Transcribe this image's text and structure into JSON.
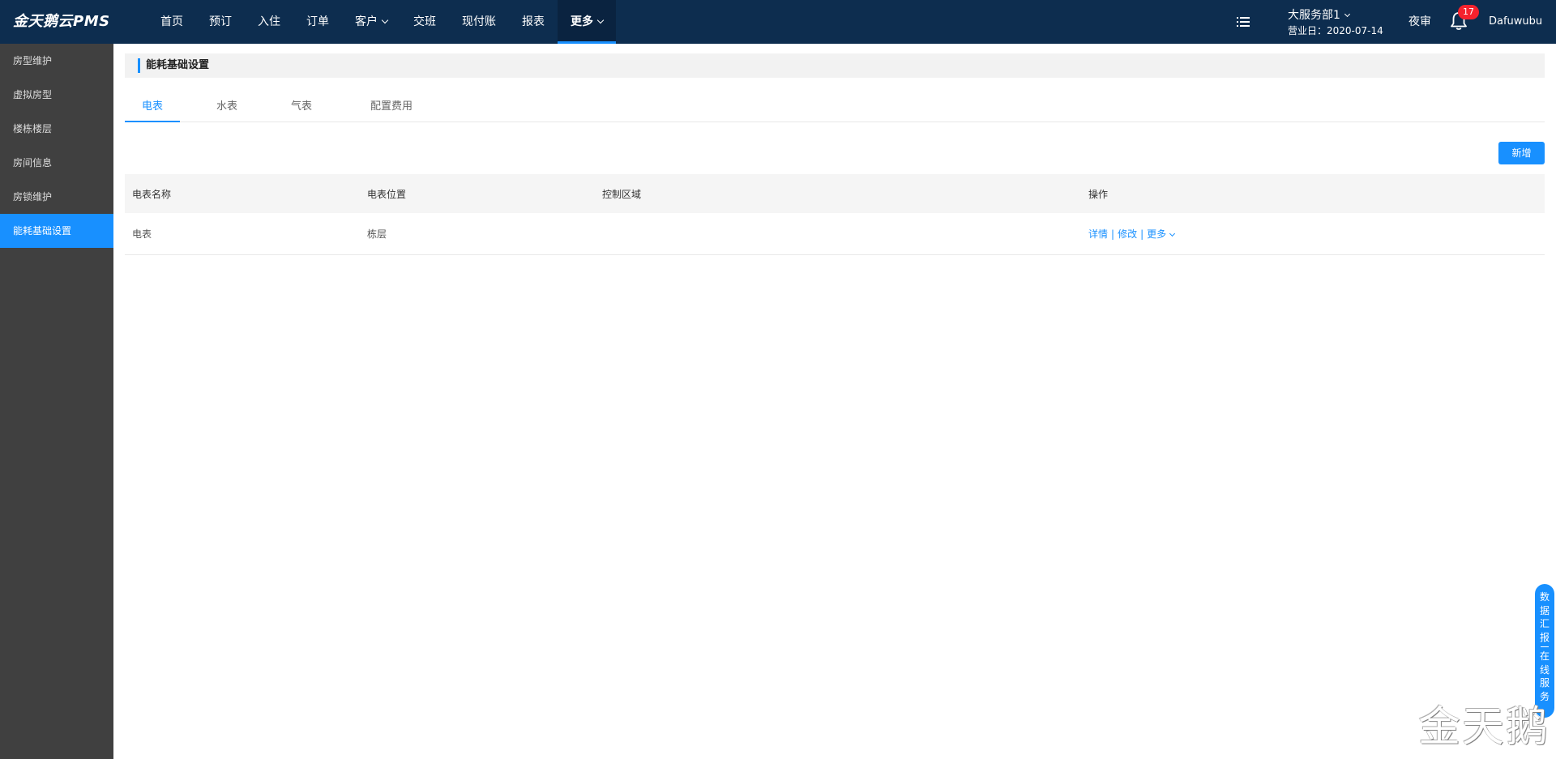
{
  "app": {
    "logo": "金天鹅云PMS"
  },
  "nav": {
    "items": [
      {
        "label": "首页"
      },
      {
        "label": "预订"
      },
      {
        "label": "入住"
      },
      {
        "label": "订单"
      },
      {
        "label": "客户"
      },
      {
        "label": "交班"
      },
      {
        "label": "现付账"
      },
      {
        "label": "报表"
      },
      {
        "label": "更多"
      }
    ],
    "active": "更多"
  },
  "header": {
    "department": "大服务部1",
    "business_date": "营业日：2020-07-14",
    "night_audit": "夜审",
    "notification_count": "17",
    "username": "Dafuwubu"
  },
  "sidebar": {
    "items": [
      {
        "label": "房型维护"
      },
      {
        "label": "虚拟房型"
      },
      {
        "label": "楼栋楼层"
      },
      {
        "label": "房间信息"
      },
      {
        "label": "房锁维护"
      },
      {
        "label": "能耗基础设置"
      }
    ],
    "active": "能耗基础设置"
  },
  "page": {
    "title": "能耗基础设置",
    "tabs": [
      {
        "label": "电表"
      },
      {
        "label": "水表"
      },
      {
        "label": "气表"
      },
      {
        "label": "配置费用"
      }
    ],
    "active_tab": "电表",
    "add_button": "新增"
  },
  "table": {
    "columns": [
      "电表名称",
      "电表位置",
      "控制区域",
      "操作"
    ],
    "rows": [
      {
        "name": "电表",
        "location": "栋层",
        "area": "",
        "actions": [
          "详情",
          "修改",
          "更多"
        ]
      }
    ]
  },
  "float_tab": {
    "top": "数据汇报",
    "bottom": "在线服务"
  },
  "watermark": "金天鹅",
  "colors": {
    "topbar": "#0d2d4f",
    "sidebar": "#404040",
    "accent": "#1890ff"
  }
}
